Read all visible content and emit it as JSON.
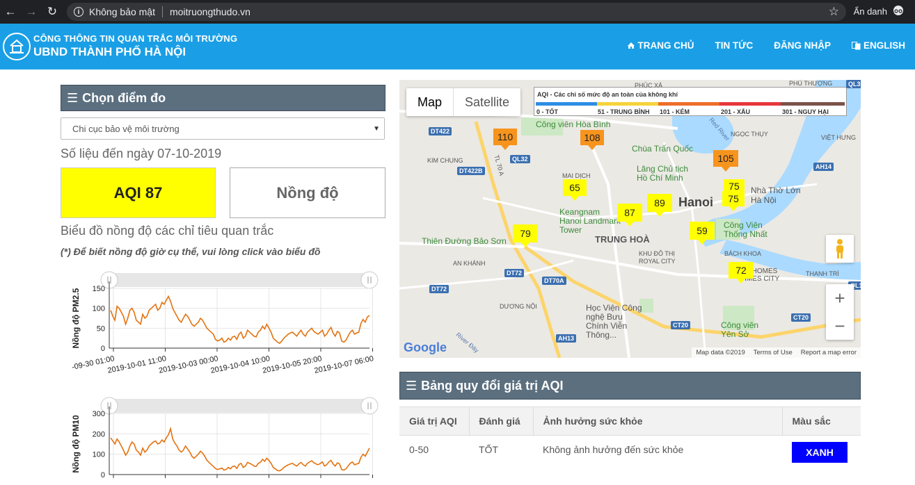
{
  "browser": {
    "security_label": "Không bảo mật",
    "url": "moitruongthudo.vn",
    "incognito_label": "Ẩn danh"
  },
  "header": {
    "line1": "CÔNG THÔNG TIN QUAN TRẮC MÔI TRƯỜNG",
    "line2": "UBND THÀNH PHỐ HÀ NỘI",
    "menu": [
      {
        "label": "TRANG CHỦ",
        "icon": "home-icon"
      },
      {
        "label": "TIN TỨC"
      },
      {
        "label": "ĐĂNG NHẬP"
      },
      {
        "label": "ENGLISH",
        "icon": "translate-icon"
      }
    ]
  },
  "left": {
    "panel_title": "Chọn điểm đo",
    "station_select": "Chi cục bảo vệ môi trường",
    "date_text": "Số liệu đến ngày 07-10-2019",
    "aqi_label": "AQI 87",
    "aqi_color": "#ffff00",
    "concentration_label": "Nồng độ",
    "chart_heading": "Biểu đồ nồng độ các chỉ tiêu quan trắc",
    "chart_note": "(*) Để biết nồng độ giờ cụ thể, vui lòng click vào biểu đồ"
  },
  "chart_data": [
    {
      "type": "line",
      "title": "",
      "ylabel": "Nồng độ PM2.5",
      "ylim": [
        0,
        150
      ],
      "yticks": [
        0,
        50,
        100,
        150
      ],
      "x_ticks": [
        "-09-30 01:00",
        "2019-10-01 11:00",
        "2019-10-03 00:00",
        "2019-10-04 10:00",
        "2019-10-05 20:00",
        "2019-10-07 06:00"
      ],
      "line_color": "#e4720f",
      "values": [
        95,
        80,
        70,
        105,
        100,
        90,
        80,
        60,
        75,
        95,
        100,
        90,
        70,
        65,
        60,
        85,
        75,
        80,
        95,
        100,
        105,
        110,
        95,
        100,
        115,
        110,
        120,
        130,
        118,
        100,
        90,
        80,
        70,
        65,
        75,
        85,
        80,
        70,
        60,
        55,
        60,
        65,
        75,
        70,
        60,
        50,
        45,
        40,
        35,
        22,
        18,
        20,
        25,
        15,
        18,
        25,
        20,
        28,
        30,
        22,
        35,
        40,
        25,
        30,
        45,
        40,
        35,
        30,
        28,
        40,
        45,
        55,
        48,
        60,
        50,
        40,
        25,
        20,
        15,
        12,
        18,
        25,
        30,
        35,
        38,
        40,
        35,
        30,
        38,
        45,
        35,
        30,
        40,
        45,
        50,
        42,
        38,
        35,
        40,
        45,
        30,
        35,
        45,
        52,
        38,
        30,
        42,
        38,
        18,
        15,
        20,
        30,
        40,
        45,
        35,
        38,
        40,
        62,
        72,
        65,
        78,
        82
      ]
    },
    {
      "type": "line",
      "title": "",
      "ylabel": "Nồng độ PM10",
      "ylim": [
        0,
        300
      ],
      "yticks": [
        0,
        100,
        200,
        300
      ],
      "line_color": "#e4720f",
      "values": [
        180,
        165,
        150,
        175,
        160,
        140,
        120,
        95,
        110,
        140,
        160,
        150,
        120,
        110,
        95,
        130,
        110,
        120,
        140,
        150,
        160,
        165,
        150,
        155,
        170,
        160,
        180,
        195,
        225,
        175,
        155,
        140,
        120,
        110,
        120,
        140,
        125,
        110,
        90,
        80,
        90,
        100,
        115,
        105,
        90,
        70,
        60,
        50,
        40,
        30,
        25,
        28,
        32,
        22,
        25,
        35,
        28,
        40,
        42,
        30,
        50,
        55,
        35,
        42,
        60,
        55,
        50,
        42,
        40,
        55,
        60,
        75,
        65,
        80,
        70,
        55,
        35,
        28,
        20,
        18,
        25,
        35,
        42,
        48,
        52,
        55,
        48,
        42,
        52,
        60,
        48,
        42,
        55,
        62,
        68,
        58,
        52,
        48,
        55,
        62,
        42,
        48,
        62,
        70,
        52,
        42,
        58,
        52,
        25,
        22,
        28,
        42,
        55,
        62,
        48,
        52,
        55,
        85,
        100,
        90,
        110,
        130
      ]
    }
  ],
  "map": {
    "map_tab": "Map",
    "satellite_tab": "Satellite",
    "legend_title": "AQI - Các chỉ số mức độ an toàn của không khí",
    "legend_levels": [
      {
        "label": "0 - TỐT",
        "color": "#2e8de6"
      },
      {
        "label": "51 - TRUNG BÌNH",
        "color": "#f6d33b"
      },
      {
        "label": "101 - KÉM",
        "color": "#ee6e2b"
      },
      {
        "label": "201 - XẤU",
        "color": "#e7373a"
      },
      {
        "label": "301 - NGUY HẠI",
        "color": "#7b5249"
      }
    ],
    "places": [
      "Công viên Hòa Bình",
      "Chùa Trấn Quốc",
      "Lăng Chủ tịch Hồ Chí Minh",
      "Hanoi",
      "TRUNG HOÀ",
      "Keangnam Hanoi Landmark Tower",
      "Thiên Đường Bảo Sơn",
      "Công Viên Thống Nhất",
      "Học Viện Công nghệ Bưu Chính Viễn Thông...",
      "Công viên Yên Sở",
      "KIM CHUNG",
      "MAI DỊCH",
      "AN KHÁNH",
      "DƯƠNG NỘI",
      "BÁCH KHOA",
      "KHU ĐÔ THỊ ROYAL CITY",
      "NGỌC THỤY",
      "VIỆT HƯNG",
      "THANH TRÌ",
      "PHÚC XÁ",
      "PHỦ THƯỢNG",
      "Nhà Thờ Lớn Hà Nội",
      "VINHOMES TIMES CITY",
      "Red River",
      "River Đáy"
    ],
    "roads": [
      "DT422",
      "DT422B",
      "QL32",
      "DT72",
      "DT70A",
      "AH13",
      "CT20",
      "AH14",
      "QL3",
      "QL1",
      "TL 70 A"
    ],
    "stations": [
      {
        "value": "110",
        "color": "#f7941d"
      },
      {
        "value": "108",
        "color": "#f7941d"
      },
      {
        "value": "105",
        "color": "#f7941d"
      },
      {
        "value": "65",
        "color": "#ffff00"
      },
      {
        "value": "87",
        "color": "#ffff00"
      },
      {
        "value": "89",
        "color": "#ffff00"
      },
      {
        "value": "75",
        "color": "#ffff00"
      },
      {
        "value": "75",
        "color": "#ffff00"
      },
      {
        "value": "59",
        "color": "#ffff00"
      },
      {
        "value": "79",
        "color": "#ffff00"
      },
      {
        "value": "72",
        "color": "#ffff00"
      }
    ],
    "attribution": [
      "Map data ©2019",
      "Terms of Use",
      "Report a map error"
    ],
    "logo": "Google"
  },
  "aqi_table": {
    "title": "Bảng quy đổi giá trị AQI",
    "headers": [
      "Giá trị AQI",
      "Đánh giá",
      "Ảnh hưởng sức khỏe",
      "Màu sắc"
    ],
    "rows": [
      {
        "range": "0-50",
        "rating": "TỐT",
        "effect": "Không ảnh hưởng đến sức khỏe",
        "color_label": "XANH",
        "color": "#0000ff"
      }
    ]
  }
}
